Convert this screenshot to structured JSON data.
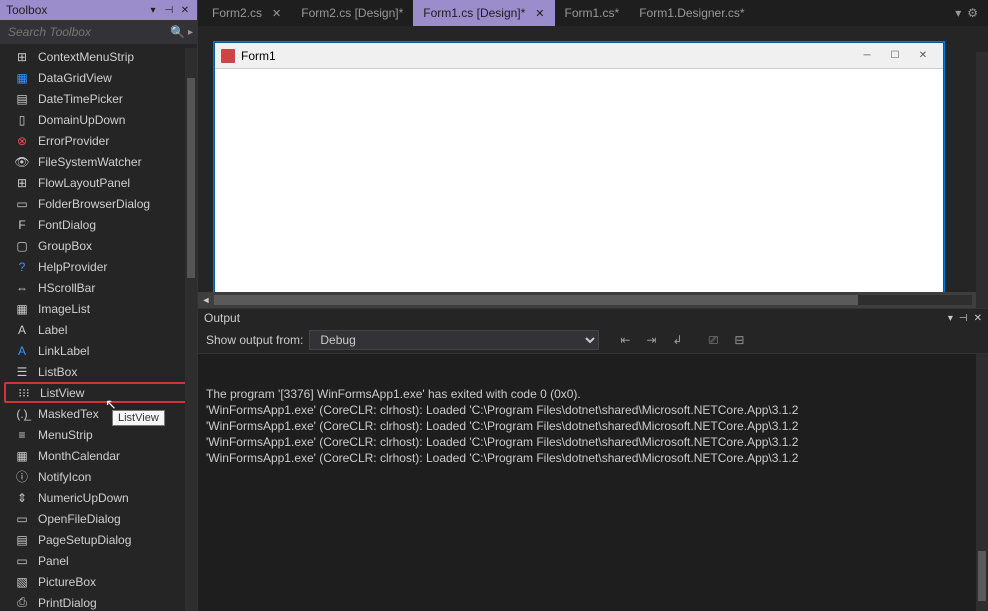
{
  "toolbox": {
    "title": "Toolbox",
    "search_placeholder": "Search Toolbox",
    "items": [
      {
        "icon": "⊞",
        "label": "ContextMenuStrip",
        "cls": "ic-white"
      },
      {
        "icon": "▦",
        "label": "DataGridView",
        "cls": "ic-blue"
      },
      {
        "icon": "▤",
        "label": "DateTimePicker",
        "cls": "ic-white"
      },
      {
        "icon": "▯",
        "label": "DomainUpDown",
        "cls": "ic-white"
      },
      {
        "icon": "⊗",
        "label": "ErrorProvider",
        "cls": "ic-red"
      },
      {
        "icon": "👁",
        "label": "FileSystemWatcher",
        "cls": "ic-white"
      },
      {
        "icon": "⊞",
        "label": "FlowLayoutPanel",
        "cls": "ic-white"
      },
      {
        "icon": "▭",
        "label": "FolderBrowserDialog",
        "cls": "ic-white"
      },
      {
        "icon": "F",
        "label": "FontDialog",
        "cls": "ic-white"
      },
      {
        "icon": "▢",
        "label": "GroupBox",
        "cls": "ic-white"
      },
      {
        "icon": "?",
        "label": "HelpProvider",
        "cls": "ic-blue"
      },
      {
        "icon": "⇔",
        "label": "HScrollBar",
        "cls": "ic-white"
      },
      {
        "icon": "▦",
        "label": "ImageList",
        "cls": "ic-white"
      },
      {
        "icon": "A",
        "label": "Label",
        "cls": "ic-white"
      },
      {
        "icon": "A",
        "label": "LinkLabel",
        "cls": "ic-blue"
      },
      {
        "icon": "☰",
        "label": "ListBox",
        "cls": "ic-white"
      },
      {
        "icon": "⁝⁝⁝",
        "label": "ListView",
        "cls": "ic-white",
        "highlight": true
      },
      {
        "icon": "(.)̲",
        "label": "MaskedTex",
        "cls": "ic-white"
      },
      {
        "icon": "≡",
        "label": "MenuStrip",
        "cls": "ic-white"
      },
      {
        "icon": "▦",
        "label": "MonthCalendar",
        "cls": "ic-white"
      },
      {
        "icon": "ⓘ",
        "label": "NotifyIcon",
        "cls": "ic-white"
      },
      {
        "icon": "⇕",
        "label": "NumericUpDown",
        "cls": "ic-white"
      },
      {
        "icon": "▭",
        "label": "OpenFileDialog",
        "cls": "ic-white"
      },
      {
        "icon": "▤",
        "label": "PageSetupDialog",
        "cls": "ic-white"
      },
      {
        "icon": "▭",
        "label": "Panel",
        "cls": "ic-white"
      },
      {
        "icon": "▧",
        "label": "PictureBox",
        "cls": "ic-white"
      },
      {
        "icon": "⎙",
        "label": "PrintDialog",
        "cls": "ic-white"
      }
    ]
  },
  "tooltip": "ListView",
  "tabs": [
    {
      "label": "Form2.cs",
      "active": false,
      "close": true
    },
    {
      "label": "Form2.cs [Design]*",
      "active": false,
      "close": false
    },
    {
      "label": "Form1.cs [Design]*",
      "active": true,
      "close": true
    },
    {
      "label": "Form1.cs*",
      "active": false,
      "close": false
    },
    {
      "label": "Form1.Designer.cs*",
      "active": false,
      "close": false
    }
  ],
  "form": {
    "title": "Form1"
  },
  "output": {
    "title": "Output",
    "label": "Show output from:",
    "source": "Debug",
    "lines": [
      "'WinFormsApp1.exe' (CoreCLR: clrhost): Loaded 'C:\\Program Files\\dotnet\\shared\\Microsoft.NETCore.App\\3.1.2",
      "'WinFormsApp1.exe' (CoreCLR: clrhost): Loaded 'C:\\Program Files\\dotnet\\shared\\Microsoft.NETCore.App\\3.1.2",
      "'WinFormsApp1.exe' (CoreCLR: clrhost): Loaded 'C:\\Program Files\\dotnet\\shared\\Microsoft.NETCore.App\\3.1.2",
      "'WinFormsApp1.exe' (CoreCLR: clrhost): Loaded 'C:\\Program Files\\dotnet\\shared\\Microsoft.NETCore.App\\3.1.2",
      "The program '[3376] WinFormsApp1.exe' has exited with code 0 (0x0)."
    ]
  }
}
